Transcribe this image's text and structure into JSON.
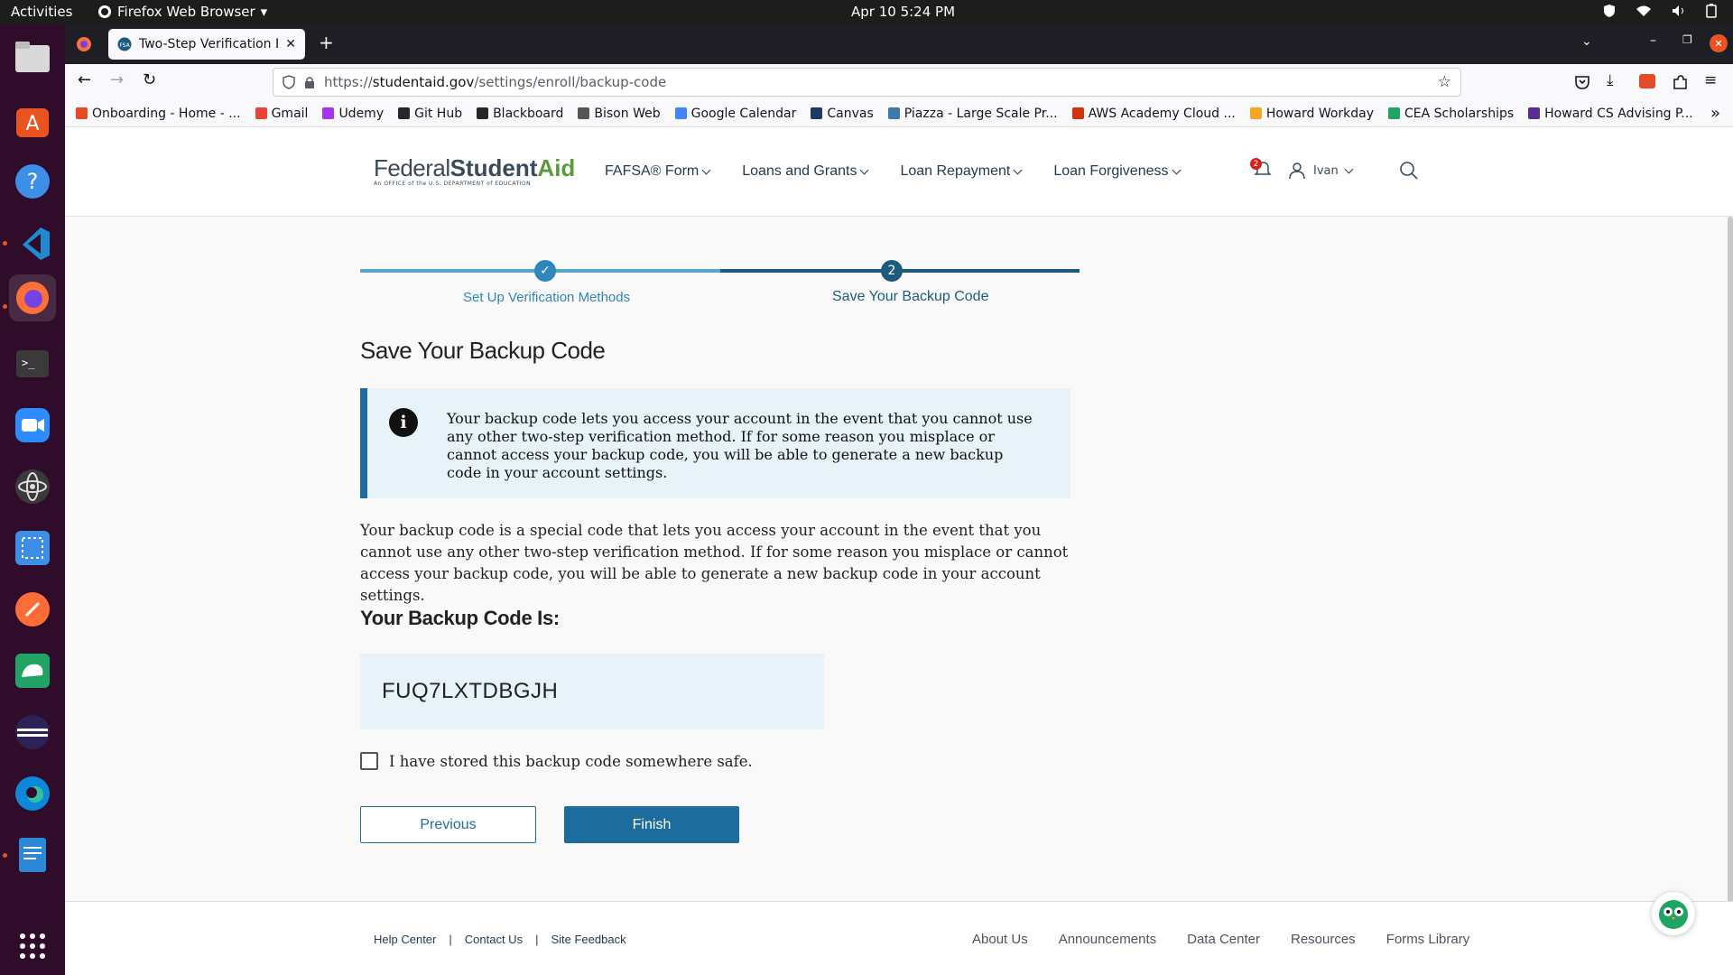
{
  "topbar": {
    "activities": "Activities",
    "app_name": "Firefox Web Browser",
    "clock": "Apr 10  5:24 PM"
  },
  "browser": {
    "tab_title": "Two-Step Verification Enr",
    "url_prefix": "https://",
    "url_host": "studentaid.gov",
    "url_path": "/settings/enroll/backup-code"
  },
  "bookmarks": [
    {
      "label": "Onboarding - Home - ...",
      "color": "#e34c26"
    },
    {
      "label": "Gmail",
      "color": "#ea4335"
    },
    {
      "label": "Udemy",
      "color": "#a435f0"
    },
    {
      "label": "Git Hub",
      "color": "#24292e"
    },
    {
      "label": "Blackboard",
      "color": "#262626"
    },
    {
      "label": "Bison Web",
      "color": "#555555"
    },
    {
      "label": "Google Calendar",
      "color": "#4285f4"
    },
    {
      "label": "Canvas",
      "color": "#1d3a63"
    },
    {
      "label": "Piazza - Large Scale Pr...",
      "color": "#3e7aab"
    },
    {
      "label": "AWS Academy Cloud ...",
      "color": "#d13212"
    },
    {
      "label": "Howard Workday",
      "color": "#f5a623"
    },
    {
      "label": "CEA Scholarships",
      "color": "#1fa463"
    },
    {
      "label": "Howard CS Advising P...",
      "color": "#5c2d91"
    }
  ],
  "site": {
    "logo_word1": "Federal",
    "logo_word2": "Student",
    "logo_word3": "Aid",
    "logo_tagline": "An OFFICE of the U.S. DEPARTMENT of EDUCATION",
    "nav": [
      "FAFSA® Form",
      "Loans and Grants",
      "Loan Repayment",
      "Loan Forgiveness"
    ],
    "notification_count": "2",
    "user_name": "Ivan"
  },
  "stepper": {
    "step1_label": "Set Up Verification Methods",
    "step2_number": "2",
    "step2_label": "Save Your Backup Code"
  },
  "main": {
    "title": "Save Your Backup Code",
    "info_text": "Your backup code lets you access your account in the event that you cannot use any other two-step verification method. If for some reason you misplace or cannot access your backup code, you will be able to generate a new backup code in your account settings.",
    "body_text": "Your backup code is a special code that lets you access your account in the event that you cannot use any other two-step verification method. If for some reason you misplace or cannot access your backup code, you will be able to generate a new backup code in your account settings.",
    "code_label": "Your Backup Code Is:",
    "code_value": "FUQ7LXTDBGJH",
    "checkbox_label": "I have stored this backup code somewhere safe.",
    "previous_label": "Previous",
    "finish_label": "Finish"
  },
  "footer": {
    "left_links": [
      "Help Center",
      "Contact Us",
      "Site Feedback"
    ],
    "separator": "|",
    "right_links": [
      "About Us",
      "Announcements",
      "Data Center",
      "Resources",
      "Forms Library"
    ]
  },
  "colors": {
    "primary": "#1c6d9e",
    "info_bg": "#e7f3f9",
    "step_complete": "#5ba4d0",
    "brand_green": "#5a9a3a",
    "dock_bg": "#2f0d2a"
  }
}
